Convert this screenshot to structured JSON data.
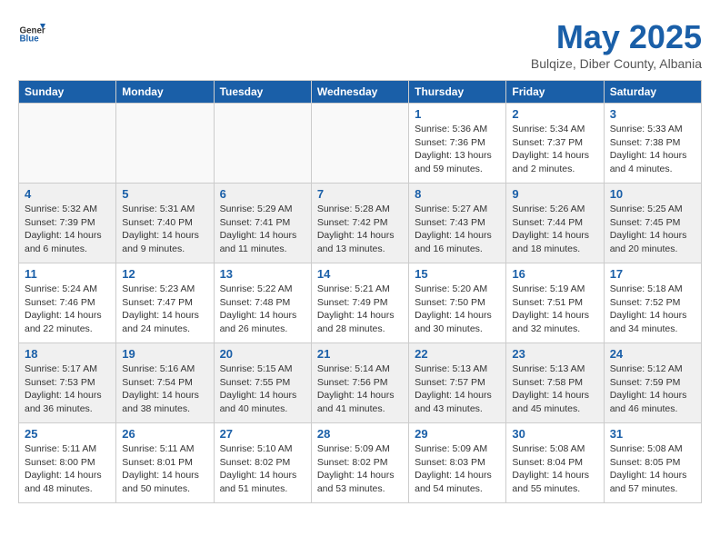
{
  "header": {
    "logo_general": "General",
    "logo_blue": "Blue",
    "month": "May 2025",
    "location": "Bulqize, Diber County, Albania"
  },
  "days_of_week": [
    "Sunday",
    "Monday",
    "Tuesday",
    "Wednesday",
    "Thursday",
    "Friday",
    "Saturday"
  ],
  "weeks": [
    [
      {
        "day": "",
        "empty": true
      },
      {
        "day": "",
        "empty": true
      },
      {
        "day": "",
        "empty": true
      },
      {
        "day": "",
        "empty": true
      },
      {
        "day": "1",
        "lines": [
          "Sunrise: 5:36 AM",
          "Sunset: 7:36 PM",
          "Daylight: 13 hours",
          "and 59 minutes."
        ]
      },
      {
        "day": "2",
        "lines": [
          "Sunrise: 5:34 AM",
          "Sunset: 7:37 PM",
          "Daylight: 14 hours",
          "and 2 minutes."
        ]
      },
      {
        "day": "3",
        "lines": [
          "Sunrise: 5:33 AM",
          "Sunset: 7:38 PM",
          "Daylight: 14 hours",
          "and 4 minutes."
        ]
      }
    ],
    [
      {
        "day": "4",
        "lines": [
          "Sunrise: 5:32 AM",
          "Sunset: 7:39 PM",
          "Daylight: 14 hours",
          "and 6 minutes."
        ]
      },
      {
        "day": "5",
        "lines": [
          "Sunrise: 5:31 AM",
          "Sunset: 7:40 PM",
          "Daylight: 14 hours",
          "and 9 minutes."
        ]
      },
      {
        "day": "6",
        "lines": [
          "Sunrise: 5:29 AM",
          "Sunset: 7:41 PM",
          "Daylight: 14 hours",
          "and 11 minutes."
        ]
      },
      {
        "day": "7",
        "lines": [
          "Sunrise: 5:28 AM",
          "Sunset: 7:42 PM",
          "Daylight: 14 hours",
          "and 13 minutes."
        ]
      },
      {
        "day": "8",
        "lines": [
          "Sunrise: 5:27 AM",
          "Sunset: 7:43 PM",
          "Daylight: 14 hours",
          "and 16 minutes."
        ]
      },
      {
        "day": "9",
        "lines": [
          "Sunrise: 5:26 AM",
          "Sunset: 7:44 PM",
          "Daylight: 14 hours",
          "and 18 minutes."
        ]
      },
      {
        "day": "10",
        "lines": [
          "Sunrise: 5:25 AM",
          "Sunset: 7:45 PM",
          "Daylight: 14 hours",
          "and 20 minutes."
        ]
      }
    ],
    [
      {
        "day": "11",
        "lines": [
          "Sunrise: 5:24 AM",
          "Sunset: 7:46 PM",
          "Daylight: 14 hours",
          "and 22 minutes."
        ]
      },
      {
        "day": "12",
        "lines": [
          "Sunrise: 5:23 AM",
          "Sunset: 7:47 PM",
          "Daylight: 14 hours",
          "and 24 minutes."
        ]
      },
      {
        "day": "13",
        "lines": [
          "Sunrise: 5:22 AM",
          "Sunset: 7:48 PM",
          "Daylight: 14 hours",
          "and 26 minutes."
        ]
      },
      {
        "day": "14",
        "lines": [
          "Sunrise: 5:21 AM",
          "Sunset: 7:49 PM",
          "Daylight: 14 hours",
          "and 28 minutes."
        ]
      },
      {
        "day": "15",
        "lines": [
          "Sunrise: 5:20 AM",
          "Sunset: 7:50 PM",
          "Daylight: 14 hours",
          "and 30 minutes."
        ]
      },
      {
        "day": "16",
        "lines": [
          "Sunrise: 5:19 AM",
          "Sunset: 7:51 PM",
          "Daylight: 14 hours",
          "and 32 minutes."
        ]
      },
      {
        "day": "17",
        "lines": [
          "Sunrise: 5:18 AM",
          "Sunset: 7:52 PM",
          "Daylight: 14 hours",
          "and 34 minutes."
        ]
      }
    ],
    [
      {
        "day": "18",
        "lines": [
          "Sunrise: 5:17 AM",
          "Sunset: 7:53 PM",
          "Daylight: 14 hours",
          "and 36 minutes."
        ]
      },
      {
        "day": "19",
        "lines": [
          "Sunrise: 5:16 AM",
          "Sunset: 7:54 PM",
          "Daylight: 14 hours",
          "and 38 minutes."
        ]
      },
      {
        "day": "20",
        "lines": [
          "Sunrise: 5:15 AM",
          "Sunset: 7:55 PM",
          "Daylight: 14 hours",
          "and 40 minutes."
        ]
      },
      {
        "day": "21",
        "lines": [
          "Sunrise: 5:14 AM",
          "Sunset: 7:56 PM",
          "Daylight: 14 hours",
          "and 41 minutes."
        ]
      },
      {
        "day": "22",
        "lines": [
          "Sunrise: 5:13 AM",
          "Sunset: 7:57 PM",
          "Daylight: 14 hours",
          "and 43 minutes."
        ]
      },
      {
        "day": "23",
        "lines": [
          "Sunrise: 5:13 AM",
          "Sunset: 7:58 PM",
          "Daylight: 14 hours",
          "and 45 minutes."
        ]
      },
      {
        "day": "24",
        "lines": [
          "Sunrise: 5:12 AM",
          "Sunset: 7:59 PM",
          "Daylight: 14 hours",
          "and 46 minutes."
        ]
      }
    ],
    [
      {
        "day": "25",
        "lines": [
          "Sunrise: 5:11 AM",
          "Sunset: 8:00 PM",
          "Daylight: 14 hours",
          "and 48 minutes."
        ]
      },
      {
        "day": "26",
        "lines": [
          "Sunrise: 5:11 AM",
          "Sunset: 8:01 PM",
          "Daylight: 14 hours",
          "and 50 minutes."
        ]
      },
      {
        "day": "27",
        "lines": [
          "Sunrise: 5:10 AM",
          "Sunset: 8:02 PM",
          "Daylight: 14 hours",
          "and 51 minutes."
        ]
      },
      {
        "day": "28",
        "lines": [
          "Sunrise: 5:09 AM",
          "Sunset: 8:02 PM",
          "Daylight: 14 hours",
          "and 53 minutes."
        ]
      },
      {
        "day": "29",
        "lines": [
          "Sunrise: 5:09 AM",
          "Sunset: 8:03 PM",
          "Daylight: 14 hours",
          "and 54 minutes."
        ]
      },
      {
        "day": "30",
        "lines": [
          "Sunrise: 5:08 AM",
          "Sunset: 8:04 PM",
          "Daylight: 14 hours",
          "and 55 minutes."
        ]
      },
      {
        "day": "31",
        "lines": [
          "Sunrise: 5:08 AM",
          "Sunset: 8:05 PM",
          "Daylight: 14 hours",
          "and 57 minutes."
        ]
      }
    ]
  ]
}
